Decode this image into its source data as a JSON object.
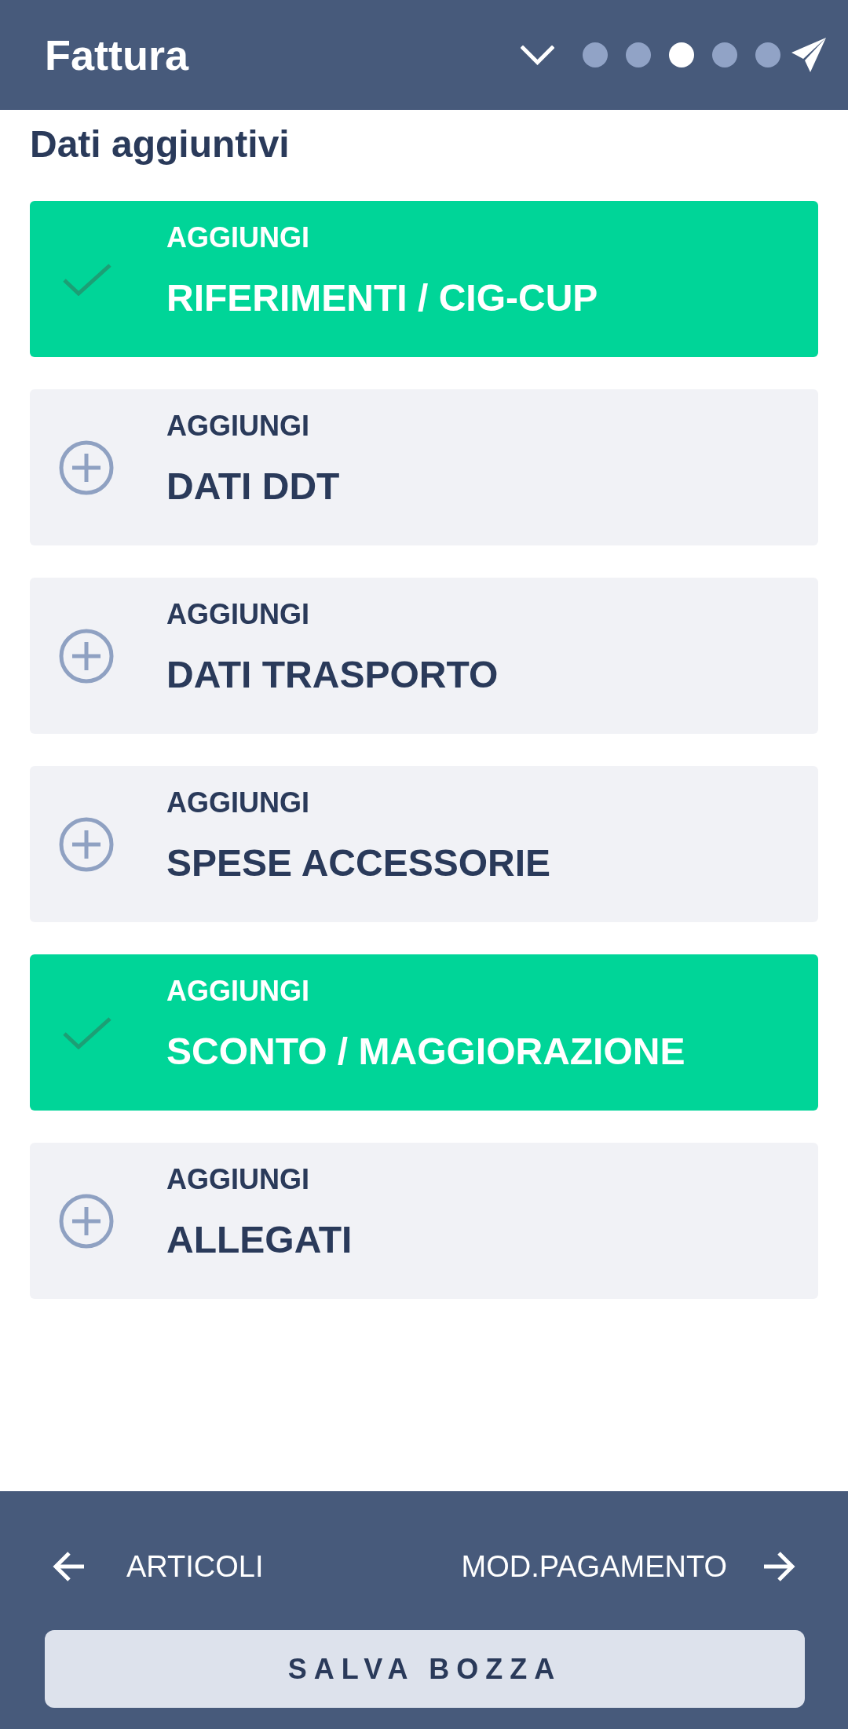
{
  "header": {
    "title": "Fattura",
    "steps": [
      {
        "selected": false
      },
      {
        "selected": false
      },
      {
        "selected": true
      },
      {
        "selected": false
      },
      {
        "selected": false
      }
    ]
  },
  "section_heading": "Dati aggiuntivi",
  "sections": [
    {
      "label": "AGGIUNGI",
      "title": "RIFERIMENTI / CIG-CUP",
      "checked": true
    },
    {
      "label": "AGGIUNGI",
      "title": "DATI DDT",
      "checked": false
    },
    {
      "label": "AGGIUNGI",
      "title": "DATI TRASPORTO",
      "checked": false
    },
    {
      "label": "AGGIUNGI",
      "title": "SPESE ACCESSORIE",
      "checked": false
    },
    {
      "label": "AGGIUNGI",
      "title": "SCONTO / MAGGIORAZIONE",
      "checked": true
    },
    {
      "label": "AGGIUNGI",
      "title": "ALLEGATI",
      "checked": false
    }
  ],
  "footer": {
    "previous": "ARTICOLI",
    "next": "MOD.PAGAMENTO",
    "save_button": "SALVA BOZZA"
  }
}
